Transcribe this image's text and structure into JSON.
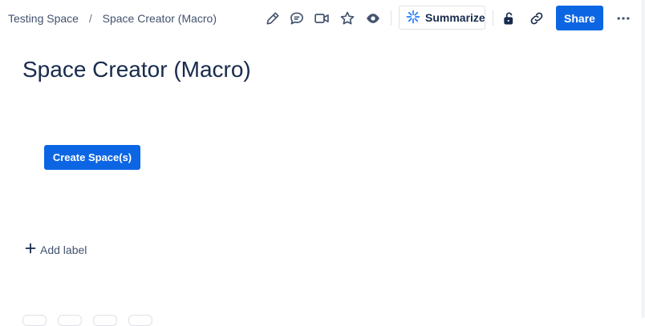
{
  "breadcrumb": {
    "space": "Testing Space",
    "separator": "/",
    "page": "Space Creator (Macro)"
  },
  "toolbar": {
    "icons": [
      "edit-icon",
      "comment-icon",
      "video-icon",
      "star-icon",
      "watch-icon"
    ],
    "summarize_label": "Summarize",
    "restrictions_icon": "unlock-icon",
    "link_icon": "link-icon",
    "share_label": "Share",
    "more_icon": "more-icon"
  },
  "page": {
    "title": "Space Creator (Macro)",
    "create_button_label": "Create Space(s)",
    "add_label": "Add label"
  },
  "colors": {
    "primary": "#0c66e4",
    "text": "#172b4d",
    "subtle_text": "#42526e",
    "border": "#dfe1e6"
  }
}
